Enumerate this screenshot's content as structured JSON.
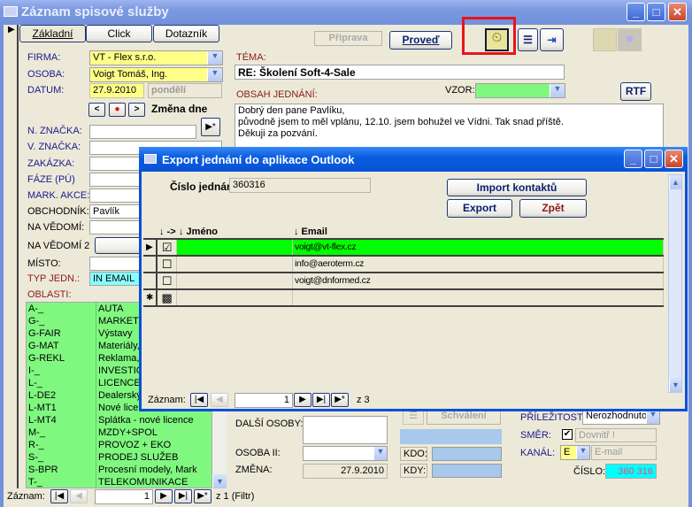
{
  "window": {
    "title": "Záznam spisové služby",
    "min": "_",
    "max": "□",
    "close": "✕"
  },
  "tabs": [
    "Základní",
    "Click",
    "Dotazník"
  ],
  "toolbar": {
    "priprava": "Připrava",
    "proved": "Proveď",
    "rtf": "RTF"
  },
  "form": {
    "firma_label": "FIRMA:",
    "firma": "VT - Flex s.r.o.",
    "osoba_label": "OSOBA:",
    "osoba": "Voigt Tomáš, Ing.",
    "datum_label": "DATUM:",
    "datum": "27.9.2010",
    "den": "pondělí",
    "zmena_dne": "Změna dne",
    "new_btn": "▶*",
    "n_znacka": "N. ZNAČKA:",
    "v_znacka": "V. ZNAČKA:",
    "zakazka": "ZAKÁZKA:",
    "faze": "FÁZE (PÚ)",
    "mark_akce": "MARK. AKCE:",
    "obchodnik_label": "OBCHODNÍK:",
    "obchodnik": "Pavlík",
    "na_vedomi": "NA VĚDOMÍ:",
    "na_vedomi2": "NA VĚDOMÍ 2",
    "vyb": "Výb",
    "misto": "MÍSTO:",
    "typ_label": "TYP JEDN.:",
    "typ": "IN EMAIL",
    "oblasti_label": "OBLASTI:",
    "tema_label": "TÉMA:",
    "tema": "RE: Školení Soft-4-Sale",
    "obsah_label": "OBSAH JEDNÁNÍ:",
    "vzor_label": "VZOR:",
    "obsah": [
      "Dobrý den pane Pavlíku,",
      "původně jsem to měl vplánu, 12.10. jsem bohužel ve Vídni. Tak snad příště.",
      "Děkuji za pozvání."
    ],
    "dalsi_osoby": "DALŠÍ OSOBY:",
    "osoba2": "OSOBA II:",
    "zmena_label": "ZMĚNA:",
    "zmena": "27.9.2010",
    "schvaleni": "Schválení",
    "kdo": "KDO:",
    "kdy": "KDY:",
    "prilezitost_label": "PŘÍLEŽITOST:",
    "prilezitost": "Nerozhodnuto",
    "smer_label": "SMĚR:",
    "smer": "Dovnitř !",
    "smer_checked": true,
    "kanal_label": "KANÁL:",
    "kanal": "E",
    "kanal_text": "E-mail",
    "cislo_label": "ČÍSLO:",
    "cislo": "360 316"
  },
  "oblasti": [
    [
      "A-_",
      "AUTA"
    ],
    [
      "G-_",
      "MARKETI"
    ],
    [
      "G-FAIR",
      "Výstavy"
    ],
    [
      "G-MAT",
      "Materiály,"
    ],
    [
      "G-REKL",
      "Reklama,"
    ],
    [
      "I-_",
      "INVESTIC"
    ],
    [
      "L-_",
      "LICENCE"
    ],
    [
      "L-DE2",
      "Dealerský"
    ],
    [
      "L-MT1",
      "Nové lice"
    ],
    [
      "L-MT4",
      "Splátka - nové licence"
    ],
    [
      "M-_",
      "MZDY+SPOL"
    ],
    [
      "R-_",
      "PROVOZ + EKO"
    ],
    [
      "S-_",
      "PRODEJ SLUŽEB"
    ],
    [
      "S-BPR",
      "Procesní modely, Mark"
    ],
    [
      "T-_",
      "TELEKOMUNIKACE"
    ]
  ],
  "nav": {
    "label": "Záznam:",
    "current": "1",
    "total": "z 1 (Filtr)"
  },
  "dialog": {
    "title": "Export jednání do aplikace Outlook",
    "cislo_label": "Číslo jednání:",
    "cislo": "360316",
    "import": "Import kontaktů",
    "export": "Export",
    "zpet": "Zpět",
    "col_check": "↓ ->",
    "col_jmeno": "↓ Jméno",
    "col_email": "↓ Email",
    "rows": [
      {
        "checked": true,
        "jmeno": "",
        "email": "voigt@vt-flex.cz"
      },
      {
        "checked": false,
        "jmeno": "",
        "email": "info@aeroterm.cz"
      },
      {
        "checked": false,
        "jmeno": "",
        "email": "voigt@dnformed.cz"
      }
    ],
    "nav": {
      "label": "Záznam:",
      "current": "1",
      "total": "z  3"
    }
  },
  "colors": {
    "highlight_row": "#00ff00",
    "list_bg": "#80f880",
    "yellow": "#ffff88",
    "cyan": "#00ffff",
    "accent": "#0a5ee0"
  }
}
